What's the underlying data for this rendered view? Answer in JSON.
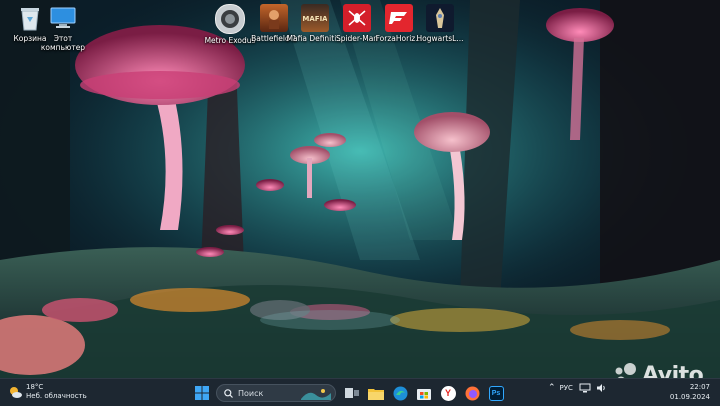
{
  "desktop": {
    "icons": [
      {
        "label": "Корзина",
        "icon": "recycle-bin-icon"
      },
      {
        "label": "Этот компьютер",
        "icon": "this-pc-icon"
      },
      {
        "label": "Metro Exodus",
        "icon": "metro-exodus-icon"
      },
      {
        "label": "Battlefield 1",
        "icon": "battlefield-icon"
      },
      {
        "label": "Mafia Definiti...",
        "icon": "mafia-icon"
      },
      {
        "label": "Spider-Man",
        "icon": "spider-man-icon"
      },
      {
        "label": "ForzaHoriz...",
        "icon": "forza-icon"
      },
      {
        "label": "HogwartsL...",
        "icon": "hogwarts-icon"
      }
    ]
  },
  "taskbar": {
    "weather": {
      "temp": "18°C",
      "desc": "Неб. облачность"
    },
    "search_placeholder": "Поиск",
    "pinned": [
      "start-icon",
      "search-icon",
      "task-view-icon",
      "file-explorer-icon",
      "edge-icon",
      "store-icon",
      "yandex-browser-icon",
      "firefox-icon",
      "photoshop-icon"
    ],
    "photoshop_label": "Ps",
    "yandex_label": "Y",
    "language": "РУС",
    "time": "22:07",
    "date": "01.09.2024"
  },
  "watermark": {
    "text": "Avito"
  },
  "colors": {
    "taskbar": "#1d2731",
    "accent": "#3aa7a4",
    "mushroom": "#e0608e"
  }
}
